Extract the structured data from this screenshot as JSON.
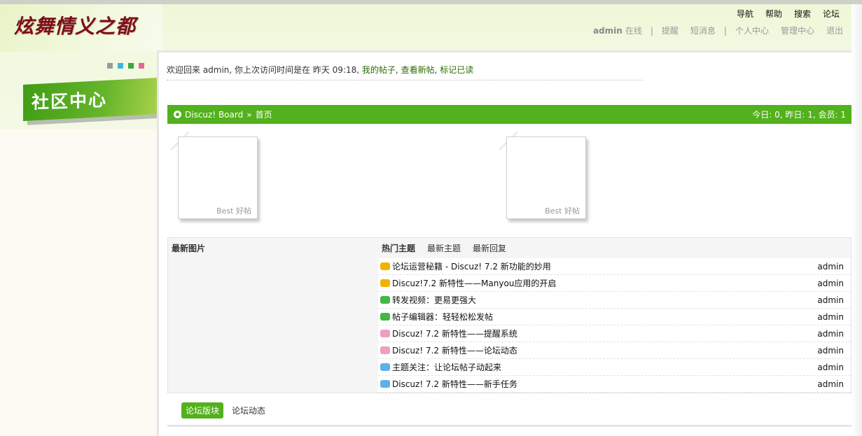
{
  "header": {
    "logo_text": "炫舞情义之都",
    "nav": [
      "导航",
      "帮助",
      "搜索",
      "论坛"
    ],
    "user": {
      "name": "admin",
      "status": "在线",
      "separator": "|",
      "links_a": [
        "提醒",
        "短消息"
      ],
      "links_b": [
        "个人中心",
        "管理中心",
        "退出"
      ]
    }
  },
  "sidebar": {
    "title": "社区中心",
    "dot_colors": [
      "#9a9a9a",
      "#3fb6d9",
      "#3aa83a",
      "#e8668f"
    ]
  },
  "welcome": {
    "text": "欢迎回来  admin, 你上次访问时间是在  昨天 09:18,",
    "links": [
      "我的帖子",
      "查看新帖",
      "标记已读"
    ],
    "separator": ","
  },
  "breadcrumb": {
    "board": "Discuz! Board",
    "arrow": "»",
    "current": "首页",
    "stats": "今日: 0, 昨日: 1, 会员: 1"
  },
  "cards": [
    {
      "label": "Best 好帖"
    },
    {
      "label": "Best 好帖"
    }
  ],
  "panel": {
    "title": "最新图片",
    "tabs": [
      "热门主题",
      "最新主题",
      "最新回复"
    ],
    "topics": [
      {
        "icon": "yellow-bubble-icon",
        "title": "论坛运营秘籍  - Discuz! 7.2 新功能的妙用",
        "author": "admin"
      },
      {
        "icon": "yellow-bubble-icon",
        "title": "Discuz!7.2 新特性——Manyou应用的开启",
        "author": "admin"
      },
      {
        "icon": "green-bubble-icon",
        "title": "转发视频：更易更强大",
        "author": "admin"
      },
      {
        "icon": "green-bubble-icon",
        "title": "帖子编辑器：轻轻松松发帖",
        "author": "admin"
      },
      {
        "icon": "pink-bubble-icon",
        "title": "Discuz! 7.2 新特性——提醒系统",
        "author": "admin"
      },
      {
        "icon": "pink-bubble-icon",
        "title": "Discuz! 7.2 新特性——论坛动态",
        "author": "admin"
      },
      {
        "icon": "blue-bubble-icon",
        "title": "主题关注：让论坛帖子动起来",
        "author": "admin"
      },
      {
        "icon": "blue-bubble-icon",
        "title": "Discuz! 7.2 新特性——新手任务",
        "author": "admin"
      }
    ]
  },
  "bottom_tabs": [
    "论坛版块",
    "论坛动态"
  ],
  "colors": {
    "accent": "#52b11c",
    "logo": "#7a0f1c"
  }
}
